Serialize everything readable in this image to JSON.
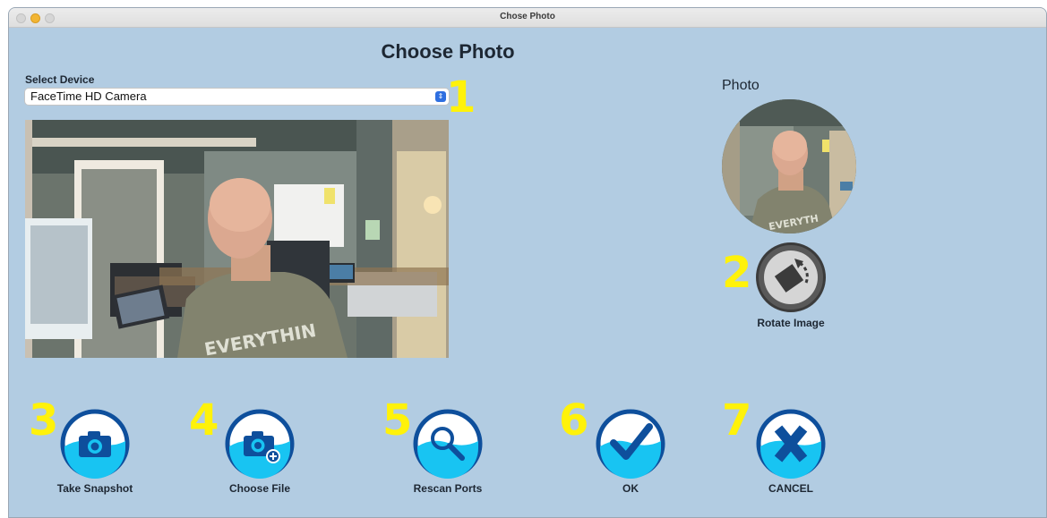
{
  "window": {
    "title": "Chose Photo"
  },
  "page": {
    "title": "Choose Photo"
  },
  "device": {
    "label": "Select Device",
    "selected": "FaceTime HD Camera"
  },
  "photo": {
    "label": "Photo"
  },
  "rotate": {
    "number": "2",
    "label": "Rotate Image",
    "icon": "rotate-icon"
  },
  "select_number": "1",
  "actions": [
    {
      "number": "3",
      "label": "Take Snapshot",
      "icon": "camera-icon"
    },
    {
      "number": "4",
      "label": "Choose File",
      "icon": "camera-add-icon"
    },
    {
      "number": "5",
      "label": "Rescan Ports",
      "icon": "magnifier-icon"
    },
    {
      "number": "6",
      "label": "OK",
      "icon": "checkmark-icon"
    },
    {
      "number": "7",
      "label": "CANCEL",
      "icon": "x-icon"
    }
  ],
  "camera_shirt_text": "EVERYTHIN",
  "colors": {
    "accent_yellow": "#fff20a",
    "button_blue": "#0e4f9c",
    "button_water": "#18c4f2",
    "window_bg": "#b2cce2"
  }
}
